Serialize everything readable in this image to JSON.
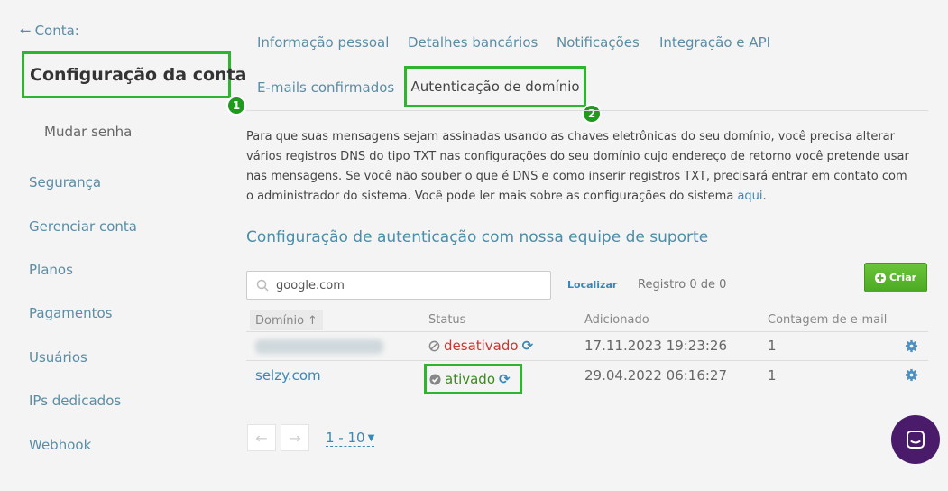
{
  "sidebar": {
    "back_label": "Conta:",
    "title": "Configuração da conta",
    "badge": "1",
    "sub_item": "Mudar senha",
    "items": [
      "Segurança",
      "Gerenciar conta",
      "Planos",
      "Pagamentos",
      "Usuários",
      "IPs dedicados",
      "Webhook"
    ]
  },
  "tabs": {
    "items": [
      "Informação pessoal",
      "Detalhes bancários",
      "Notificações",
      "Integração e API",
      "E-mails confirmados"
    ],
    "active": "Autenticação de domínio",
    "badge": "2"
  },
  "description": {
    "text": "Para que suas mensagens sejam assinadas usando as chaves eletrônicas do seu domínio, você precisa alterar vários registros DNS do tipo TXT nas configurações do seu domínio cujo endereço de retorno você pretende usar nas mensagens. Se você não souber o que é DNS e como inserir registros TXT, precisará entrar em contato com o administrador do sistema. Você pode ler mais sobre as configurações do sistema ",
    "link": "aqui",
    "end": "."
  },
  "section_title": "Configuração de autenticação com nossa equipe de suporte",
  "search": {
    "value": "google.com",
    "button": "Localizar",
    "count": "Registro 0 de 0"
  },
  "create_button": "Criar",
  "table": {
    "headers": {
      "domain": "Domínio",
      "status": "Status",
      "added": "Adicionado",
      "count": "Contagem de e-mail"
    },
    "rows": [
      {
        "domain": "",
        "status": "desativado",
        "added": "17.11.2023 19:23:26",
        "count": "1"
      },
      {
        "domain": "selzy.com",
        "status": "ativado",
        "added": "29.04.2022 06:16:27",
        "count": "1"
      }
    ]
  },
  "pagination": {
    "range": "1 - 10"
  },
  "colors": {
    "highlight": "#2db52d",
    "link": "#3b88b5",
    "primary_btn": "#58b52b",
    "danger": "#cc3333",
    "chat": "#4a1a6b"
  }
}
